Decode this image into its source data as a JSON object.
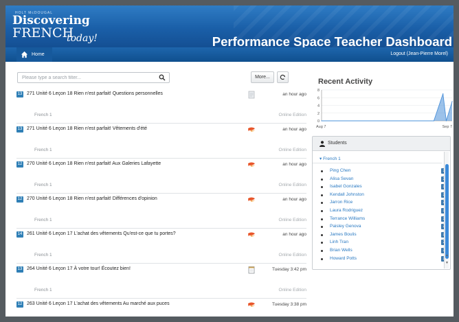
{
  "brand": {
    "small": "HOLT McDOUGAL",
    "line1": "Discovering",
    "line2": "FRENCH",
    "line3": "today!"
  },
  "header": {
    "title": "Performance Space Teacher Dashboard"
  },
  "nav": {
    "home_label": "Home",
    "logout_label": "Logout (Jean-Pierre Morel)"
  },
  "toolbar": {
    "search_placeholder": "Please type a search filter...",
    "more_label": "More..."
  },
  "activities": [
    {
      "badge": "13",
      "title": "271 Unité 6 Leçon 18 Rien n'est parfait! Questions personnelles",
      "course": "French 1",
      "time": "an hour ago",
      "edition": "Online Edition",
      "icon": "document-icon"
    },
    {
      "badge": "13",
      "title": "271 Unité 6 Leçon 18 Rien n'est parfait! Vêtements d'été",
      "course": "French 1",
      "time": "an hour ago",
      "edition": "Online Edition",
      "icon": "speech-icon"
    },
    {
      "badge": "12",
      "title": "270 Unité 6 Leçon 18 Rien n'est parfait! Aux Galeries Lafayette",
      "course": "French 1",
      "time": "an hour ago",
      "edition": "Online Edition",
      "icon": "speech-icon"
    },
    {
      "badge": "12",
      "title": "270 Unité 6 Leçon 18 Rien n'est parfait! Différences d'opinion",
      "course": "French 1",
      "time": "an hour ago",
      "edition": "Online Edition",
      "icon": "speech-icon"
    },
    {
      "badge": "14",
      "title": "261 Unité 6 Leçon 17 L'achat des vêtements Qu'est-ce que tu portes?",
      "course": "French 1",
      "time": "an hour ago",
      "edition": "Online Edition",
      "icon": "speech-icon"
    },
    {
      "badge": "13",
      "title": "264 Unité 6 Leçon 17 À votre tour! Écoutez bien!",
      "course": "French 1",
      "time": "Tuesday 3:42 pm",
      "edition": "Online Edition",
      "icon": "notepad-icon"
    },
    {
      "badge": "12",
      "title": "263 Unité 6 Leçon 17 L'achat des vêtements Au marché aux puces",
      "course": "French 1",
      "time": "Tuesday 3:38 pm",
      "edition": "Online Edition",
      "icon": "speech-icon"
    }
  ],
  "recent_activity": {
    "title": "Recent Activity"
  },
  "chart_data": {
    "type": "area",
    "x_start_label": "Aug 7",
    "x_end_label": "Sep 7",
    "y_ticks": [
      0,
      2,
      4,
      6,
      8
    ],
    "ylim": [
      0,
      8
    ],
    "x": [
      0,
      0.86,
      0.93,
      0.955,
      1.0
    ],
    "values": [
      0,
      0,
      7,
      0,
      5
    ],
    "color": "#4a90d9"
  },
  "students": {
    "title": "Students",
    "group": "French 1",
    "items": [
      {
        "name": "Ping Chen",
        "count": "25"
      },
      {
        "name": "Alisa Sevan",
        "count": "26"
      },
      {
        "name": "Isabel Gonzales",
        "count": "23"
      },
      {
        "name": "Kendall Johnston",
        "count": "28"
      },
      {
        "name": "Jarron Rice",
        "count": "25"
      },
      {
        "name": "Laura Rodriguez",
        "count": "24"
      },
      {
        "name": "Terrance Williams",
        "count": "25"
      },
      {
        "name": "Paisley Genova",
        "count": "26"
      },
      {
        "name": "James Boulis",
        "count": "25"
      },
      {
        "name": "Linh Tran",
        "count": "27"
      },
      {
        "name": "Brian Wells",
        "count": "23"
      },
      {
        "name": "Howard Potts",
        "count": "25"
      }
    ]
  }
}
